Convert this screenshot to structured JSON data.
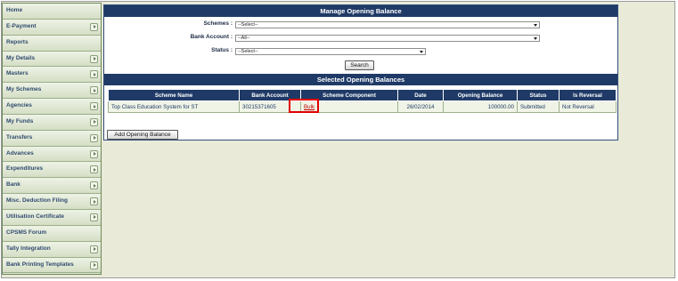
{
  "sidebar": {
    "items": [
      {
        "label": "Home",
        "has_arrow": false
      },
      {
        "label": "E-Payment",
        "has_arrow": true
      },
      {
        "label": "Reports",
        "has_arrow": false
      },
      {
        "label": "My Details",
        "has_arrow": true
      },
      {
        "label": "Masters",
        "has_arrow": true
      },
      {
        "label": "My Schemes",
        "has_arrow": true
      },
      {
        "label": "Agencies",
        "has_arrow": true
      },
      {
        "label": "My Funds",
        "has_arrow": true
      },
      {
        "label": "Transfers",
        "has_arrow": true
      },
      {
        "label": "Advances",
        "has_arrow": true
      },
      {
        "label": "Expenditures",
        "has_arrow": true
      },
      {
        "label": "Bank",
        "has_arrow": true
      },
      {
        "label": "Misc. Deduction Filing",
        "has_arrow": true
      },
      {
        "label": "Utilisation Certificate",
        "has_arrow": true
      },
      {
        "label": "CPSMS Forum",
        "has_arrow": false
      },
      {
        "label": "Tally Integration",
        "has_arrow": true
      },
      {
        "label": "Bank Printing Templates",
        "has_arrow": true
      }
    ]
  },
  "manage": {
    "title": "Manage Opening Balance",
    "schemes_label": "Schemes :",
    "schemes_value": "--Select--",
    "bank_account_label": "Bank Account :",
    "bank_account_value": "--All--",
    "status_label": "Status :",
    "status_value": "--Select--",
    "search_button": "Search"
  },
  "selected": {
    "title": "Selected Opening Balances",
    "columns": [
      "Scheme Name",
      "Bank Account",
      "Scheme Component",
      "Date",
      "Opening Balance",
      "Status",
      "Is Reversal"
    ],
    "rows": [
      {
        "scheme_name": "Top Class Education System for ST",
        "bank_account": "30215371605",
        "scheme_component": "Bulk",
        "date": "26/02/2014",
        "opening_balance": "100000.00",
        "status": "Submitted",
        "is_reversal": "Not Reversal"
      }
    ],
    "add_button": "Add Opening Balance"
  },
  "colors": {
    "header_bg": "#1f3a66",
    "sidebar_text": "#2f4b6e",
    "highlight": "#e00000",
    "link": "#c00000"
  }
}
